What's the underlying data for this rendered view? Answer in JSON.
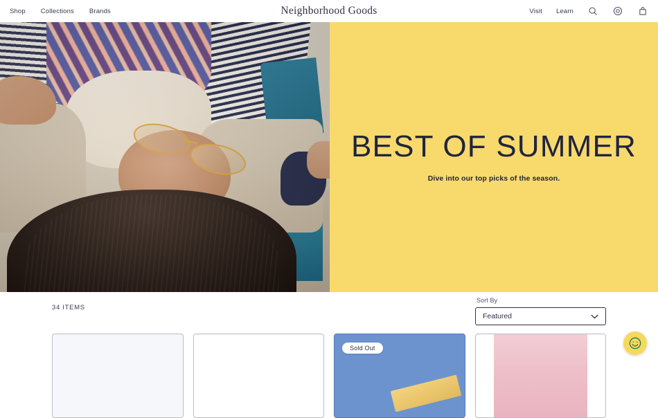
{
  "header": {
    "logo": "Neighborhood Goods",
    "nav_left": [
      {
        "label": "Shop",
        "name": "nav-shop"
      },
      {
        "label": "Collections",
        "name": "nav-collections"
      },
      {
        "label": "Brands",
        "name": "nav-brands"
      }
    ],
    "nav_right": [
      {
        "label": "Visit",
        "name": "nav-visit"
      },
      {
        "label": "Learn",
        "name": "nav-learn"
      }
    ],
    "icons": [
      {
        "name": "search-icon",
        "glyph": "search"
      },
      {
        "name": "account-icon",
        "glyph": "account-circle"
      },
      {
        "name": "cart-icon",
        "glyph": "shopping-bag"
      }
    ]
  },
  "hero": {
    "title": "BEST OF SUMMER",
    "subtitle": "Dive into our top picks of the season.",
    "background_color": "#f8d96b",
    "text_color": "#20243f",
    "image_alt": "Person lying down outdoors wearing sunglasses and a patterned shirt"
  },
  "toolbar": {
    "items_count": "34 ITEMS",
    "sort_label": "Sort By",
    "sort_value": "Featured",
    "sort_options": [
      "Featured"
    ]
  },
  "products": [
    {
      "name": "product-card-1",
      "tint": "tint-lavender",
      "badge": "",
      "color": "#f6f7fb"
    },
    {
      "name": "product-card-2",
      "tint": "tint-white",
      "badge": "",
      "color": "#ffffff"
    },
    {
      "name": "product-card-3",
      "tint": "tint-blue",
      "badge": "Sold Out",
      "color": "#6c93ce"
    },
    {
      "name": "product-card-4",
      "tint": "tint-pinkband",
      "badge": "",
      "color": "#eebfc9"
    }
  ],
  "chat": {
    "name": "chat-widget",
    "color": "#f5d95f",
    "icon_color": "#1f7a4d",
    "icon": "smiley-face"
  }
}
